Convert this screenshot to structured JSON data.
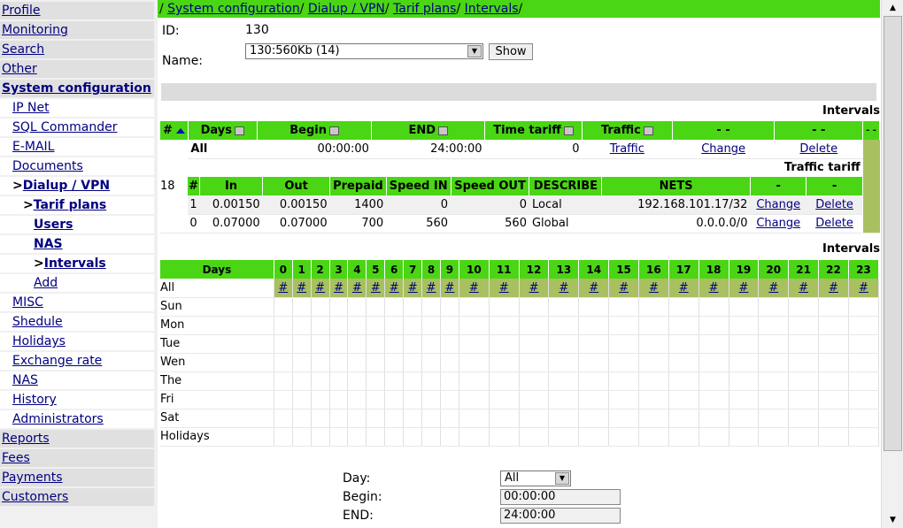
{
  "sidebar": {
    "items": [
      {
        "label": "Profile",
        "level": 0
      },
      {
        "label": "Monitoring",
        "level": 0
      },
      {
        "label": "Search",
        "level": 0
      },
      {
        "label": "Other",
        "level": 0
      },
      {
        "label": "System configuration",
        "level": 0
      },
      {
        "label": "IP Net",
        "level": 1
      },
      {
        "label": "SQL Commander",
        "level": 1
      },
      {
        "label": "E-MAIL",
        "level": 1
      },
      {
        "label": "Documents",
        "level": 1
      },
      {
        "label": "Dialup / VPN",
        "level": 1
      },
      {
        "label": "Tarif plans",
        "level": 2
      },
      {
        "label": "Users",
        "level": 3
      },
      {
        "label": "NAS",
        "level": 3
      },
      {
        "label": "Intervals",
        "level": 3
      },
      {
        "label": "Add",
        "level": 3
      },
      {
        "label": "MISC",
        "level": 1
      },
      {
        "label": "Shedule",
        "level": 1
      },
      {
        "label": "Holidays",
        "level": 1
      },
      {
        "label": "Exchange rate",
        "level": 1
      },
      {
        "label": "NAS",
        "level": 1
      },
      {
        "label": "History",
        "level": 1
      },
      {
        "label": "Administrators",
        "level": 1
      },
      {
        "label": "Reports",
        "level": 0
      },
      {
        "label": "Fees",
        "level": 0
      },
      {
        "label": "Payments",
        "level": 0
      },
      {
        "label": "Customers",
        "level": 0
      }
    ],
    "arrow": ">"
  },
  "breadcrumb": {
    "sep": "/",
    "items": [
      "System configuration",
      "Dialup / VPN",
      "Tarif plans",
      "Intervals"
    ]
  },
  "form": {
    "id_label": "ID:",
    "id_value": "130",
    "name_label": "Name:",
    "name_value": "130:560Kb (14)",
    "show_label": "Show"
  },
  "intervals_title": "Intervals",
  "intervals_table": {
    "headers": [
      "#",
      "Days",
      "Begin",
      "END",
      "Time tariff",
      "Traffic",
      "- -",
      "- -",
      "- -"
    ],
    "row": {
      "day": "All",
      "begin": "00:00:00",
      "end": "24:00:00",
      "time_tariff": "0",
      "traffic": "Traffic",
      "change": "Change",
      "delete": "Delete"
    },
    "row_id": "18"
  },
  "traffic_title": "Traffic tariff",
  "traffic_table": {
    "headers": [
      "#",
      "In",
      "Out",
      "Prepaid",
      "Speed IN",
      "Speed OUT",
      "DESCRIBE",
      "NETS",
      "-",
      "-"
    ],
    "rows": [
      {
        "n": "1",
        "in": "0.00150",
        "out": "0.00150",
        "prepaid": "1400",
        "speed_in": "0",
        "speed_out": "0",
        "describe": "Local",
        "nets": "192.168.101.17/32",
        "change": "Change",
        "delete": "Delete"
      },
      {
        "n": "0",
        "in": "0.07000",
        "out": "0.07000",
        "prepaid": "700",
        "speed_in": "560",
        "speed_out": "560",
        "describe": "Global",
        "nets": "0.0.0.0/0",
        "change": "Change",
        "delete": "Delete"
      }
    ]
  },
  "hours_title": "Intervals",
  "hours_table": {
    "days_header": "Days",
    "hours": [
      "0",
      "1",
      "2",
      "3",
      "4",
      "5",
      "6",
      "7",
      "8",
      "9",
      "10",
      "11",
      "12",
      "13",
      "14",
      "15",
      "16",
      "17",
      "18",
      "19",
      "20",
      "21",
      "22",
      "23"
    ],
    "all_label": "All",
    "hash": "#",
    "days": [
      "Sun",
      "Mon",
      "Tue",
      "Wen",
      "The",
      "Fri",
      "Sat",
      "Holidays"
    ]
  },
  "add_form": {
    "day_label": "Day:",
    "day_value": "All",
    "begin_label": "Begin:",
    "begin_value": "00:00:00",
    "end_label": "END:",
    "end_value": "24:00:00"
  },
  "colors": {
    "accent": "#4ad614",
    "olive": "#a8c060",
    "link": "#000080"
  }
}
